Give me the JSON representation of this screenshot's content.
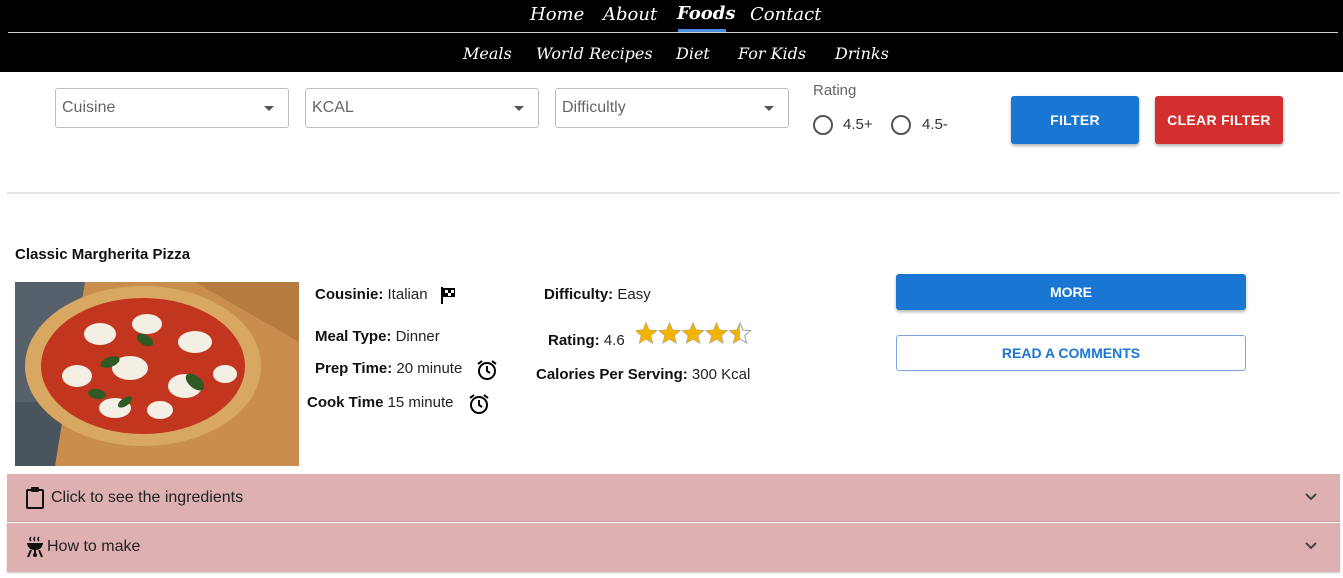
{
  "nav": {
    "primary": [
      {
        "label": "Home",
        "active": false
      },
      {
        "label": "About",
        "active": false
      },
      {
        "label": "Foods",
        "active": true
      },
      {
        "label": "Contact",
        "active": false
      }
    ],
    "secondary": [
      {
        "label": "Meals"
      },
      {
        "label": "World Recipes"
      },
      {
        "label": "Diet"
      },
      {
        "label": "For Kids"
      },
      {
        "label": "Drinks"
      }
    ]
  },
  "filters": {
    "cuisine_placeholder": "Cuisine",
    "kcal_placeholder": "KCAL",
    "difficulty_placeholder": "Difficultly",
    "rating_label": "Rating",
    "rating_options": [
      "4.5+",
      "4.5-"
    ],
    "filter_button": "FILTER",
    "clear_button": "CLEAR FILTER"
  },
  "recipe": {
    "title": "Classic Margherita Pizza",
    "cuisine_label": "Cousinie:",
    "cuisine_value": "Italian",
    "meal_type_label": "Meal Type:",
    "meal_type_value": "Dinner",
    "prep_label": "Prep Time:",
    "prep_value": "20 minute",
    "cook_label": "Cook Time",
    "cook_value": "15 minute",
    "difficulty_label": "Difficulty:",
    "difficulty_value": "Easy",
    "rating_label": "Rating:",
    "rating_value": "4.6",
    "rating_stars": 4.5,
    "calories_label": "Calories Per Serving:",
    "calories_value": "300 Kcal",
    "more_button": "MORE",
    "comments_button": "READ A COMMENTS"
  },
  "accordions": {
    "ingredients": "Click to see the ingredients",
    "how_to_make": "How to make"
  },
  "colors": {
    "primary": "#1976d2",
    "danger": "#d32f2f",
    "accordion": "#deb0b1",
    "star": "#f5b301",
    "nav_bg": "#000000"
  },
  "icons": {
    "cuisine": "flag-icon",
    "time": "alarm-clock-icon",
    "ingredients": "clipboard-icon",
    "how_to_make": "grill-icon",
    "expand": "chevron-down-icon"
  }
}
